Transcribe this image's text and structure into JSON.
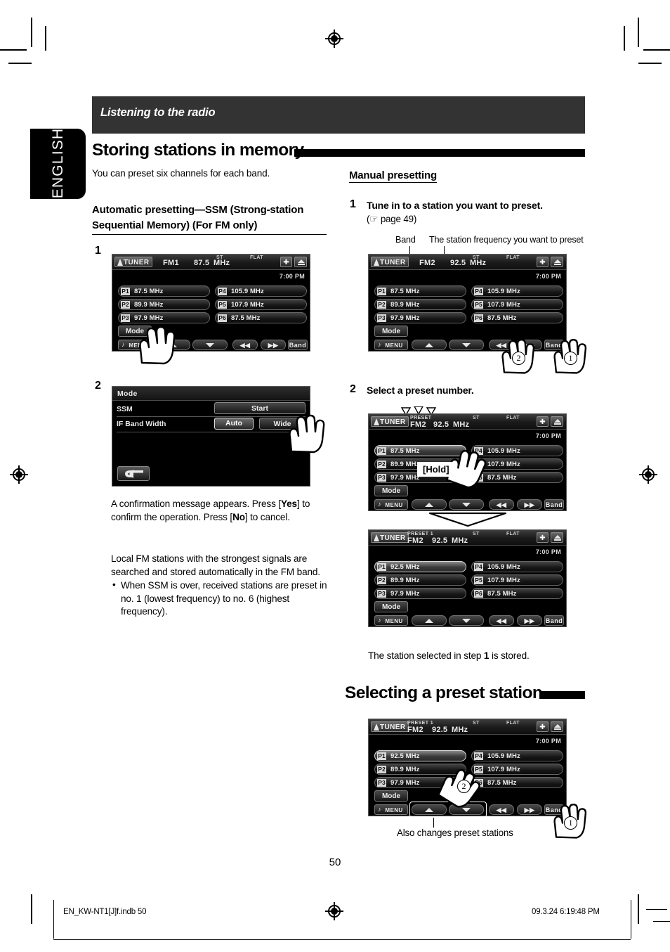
{
  "page": {
    "language_tab": "ENGLISH",
    "running_head": "Listening to the radio",
    "page_number": "50",
    "footer_left": "EN_KW-NT1[J]f.indb   50",
    "footer_right": "09.3.24   6:19:48 PM"
  },
  "section": {
    "title": "Storing stations in memory",
    "intro": "You can preset six channels for each band."
  },
  "automatic": {
    "heading_line1": "Automatic presetting—SSM (Strong-station",
    "heading_line2": "Sequential Memory) (For FM only)",
    "step1_num": "1",
    "step2_num": "2",
    "note1": "A confirmation message appears. Press [Yes] to confirm the operation. Press [No] to cancel.",
    "note1_parts": {
      "a": "A confirmation message appears. Press [",
      "b": "Yes",
      "c": "] to confirm the operation. Press [",
      "d": "No",
      "e": "] to cancel."
    },
    "note2": "Local FM stations with the strongest signals are searched and stored automatically in the FM band.",
    "bullet1": "When SSM is over, received stations are preset in no. 1 (lowest frequency) to no. 6 (highest frequency)."
  },
  "manual": {
    "heading": "Manual presetting",
    "step1_num": "1",
    "step1_text": "Tune in to a station you want to preset.",
    "step1_ref": "( page 49)",
    "step1_ref_prefix": "(",
    "step1_ref_page": "page 49)",
    "callout_band": "Band",
    "callout_freq": "The station frequency you want to preset",
    "step2_num": "2",
    "step2_text": "Select a preset number.",
    "hold_label": "[Hold]",
    "result_text": "The station selected in step 1 is stored.",
    "result_parts": {
      "a": "The station selected in step ",
      "b": "1",
      "c": " is stored."
    }
  },
  "selecting": {
    "title": "Selecting a preset station",
    "caption": "Also changes preset stations"
  },
  "mode_screen": {
    "title": "Mode",
    "rows": [
      {
        "label": "SSM",
        "buttons": [
          "Start"
        ]
      },
      {
        "label": "IF Band Width",
        "buttons": [
          "Auto",
          "Wide"
        ]
      }
    ],
    "back_icon": "back-arrow-icon"
  },
  "device_common": {
    "source_label": "TUNER",
    "st_label": "ST",
    "eq_label": "FLAT",
    "clock": "7:00 PM",
    "bluetooth_icon": "bluetooth-icon",
    "eject_icon": "eject-icon",
    "mode_button": "Mode",
    "menu_button": "MENU",
    "band_button": "Band",
    "prev_button": "|<<",
    "next_button": ">>|",
    "up_button": "up-triangle-icon",
    "down_button": "down-triangle-icon"
  },
  "screens": [
    {
      "id": "ssm-step1",
      "preset_tag": "",
      "band": "FM1",
      "freq": "87.5",
      "unit": "MHz",
      "presets": [
        {
          "tag": "P1",
          "freq": "87.5 MHz",
          "selected": false
        },
        {
          "tag": "P2",
          "freq": "89.9 MHz",
          "selected": false
        },
        {
          "tag": "P3",
          "freq": "97.9 MHz",
          "selected": false
        },
        {
          "tag": "P4",
          "freq": "105.9 MHz",
          "selected": false
        },
        {
          "tag": "P5",
          "freq": "107.9 MHz",
          "selected": false
        },
        {
          "tag": "P6",
          "freq": "87.5 MHz",
          "selected": false
        }
      ]
    },
    {
      "id": "manual-step1",
      "preset_tag": "",
      "band": "FM2",
      "freq": "92.5",
      "unit": "MHz",
      "presets": [
        {
          "tag": "P1",
          "freq": "87.5 MHz",
          "selected": false
        },
        {
          "tag": "P2",
          "freq": "89.9 MHz",
          "selected": false
        },
        {
          "tag": "P3",
          "freq": "97.9 MHz",
          "selected": false
        },
        {
          "tag": "P4",
          "freq": "105.9 MHz",
          "selected": false
        },
        {
          "tag": "P5",
          "freq": "107.9 MHz",
          "selected": false
        },
        {
          "tag": "P6",
          "freq": "87.5 MHz",
          "selected": false
        }
      ]
    },
    {
      "id": "manual-step2-hold",
      "preset_tag": "PRESET",
      "band": "FM2",
      "freq": "92.5",
      "unit": "MHz",
      "presets": [
        {
          "tag": "P1",
          "freq": "87.5 MHz",
          "selected": true
        },
        {
          "tag": "P2",
          "freq": "89.9 MHz",
          "selected": false
        },
        {
          "tag": "P3",
          "freq": "97.9 MHz",
          "selected": false
        },
        {
          "tag": "P4",
          "freq": "105.9 MHz",
          "selected": false
        },
        {
          "tag": "P5",
          "freq": "107.9 MHz",
          "selected": false
        },
        {
          "tag": "P6",
          "freq": "87.5 MHz",
          "selected": false
        }
      ]
    },
    {
      "id": "manual-step2-result",
      "preset_tag": "PRESET 1",
      "band": "FM2",
      "freq": "92.5",
      "unit": "MHz",
      "presets": [
        {
          "tag": "P1",
          "freq": "92.5 MHz",
          "selected": true
        },
        {
          "tag": "P2",
          "freq": "89.9 MHz",
          "selected": false
        },
        {
          "tag": "P3",
          "freq": "97.9 MHz",
          "selected": false
        },
        {
          "tag": "P4",
          "freq": "105.9 MHz",
          "selected": false
        },
        {
          "tag": "P5",
          "freq": "107.9 MHz",
          "selected": false
        },
        {
          "tag": "P6",
          "freq": "87.5 MHz",
          "selected": false
        }
      ]
    },
    {
      "id": "select-preset",
      "preset_tag": "PRESET 1",
      "band": "FM2",
      "freq": "92.5",
      "unit": "MHz",
      "presets": [
        {
          "tag": "P1",
          "freq": "92.5 MHz",
          "selected": true
        },
        {
          "tag": "P2",
          "freq": "89.9 MHz",
          "selected": false
        },
        {
          "tag": "P3",
          "freq": "97.9 MHz",
          "selected": false
        },
        {
          "tag": "P4",
          "freq": "105.9 MHz",
          "selected": false
        },
        {
          "tag": "P5",
          "freq": "107.9 MHz",
          "selected": false
        },
        {
          "tag": "P6",
          "freq": "87.5 MHz",
          "selected": false
        }
      ]
    }
  ],
  "annotations": {
    "circle_one": "1",
    "circle_two": "2"
  },
  "colors": {
    "runhead_bg": "#333333",
    "ink": "#000000",
    "paper": "#ffffff",
    "screen_bg": "#000000"
  }
}
